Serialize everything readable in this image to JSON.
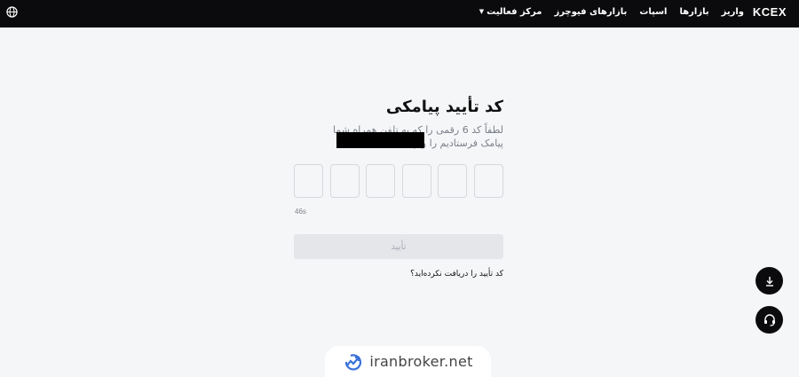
{
  "header": {
    "logo": "KCEX",
    "nav": [
      "واریز",
      "بازارها",
      "اسپات",
      "بازارهای فیوچرز",
      "مرکز فعالیت"
    ],
    "globe_icon": "globe-icon"
  },
  "verify": {
    "title": "کد تأیید پیامکی",
    "description": "لطفاً کد 6 رقمی را که به تلفن همراه شما پیامک فرستادیم را وارد کنید",
    "otp_digits": [
      "",
      "",
      "",
      "",
      "",
      ""
    ],
    "timer": "46s",
    "confirm_label": "تأیید",
    "resend_link": "کد تأیید را دریافت نکرده‌اید؟"
  },
  "floating": {
    "download_icon": "download-icon",
    "support_icon": "headset-icon"
  },
  "watermark": {
    "text": "iranbroker.net",
    "accent": "#3a72d8"
  },
  "colors": {
    "header_bg": "#0b0b0d",
    "page_bg": "#f5f6f8",
    "button_disabled_bg": "#e4e6ea"
  }
}
